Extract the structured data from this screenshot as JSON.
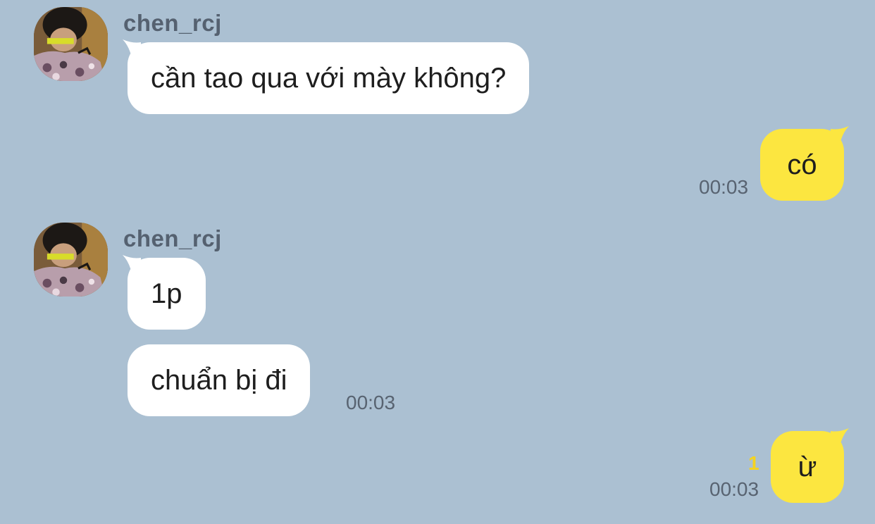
{
  "colors": {
    "background": "#abc0d2",
    "incoming_bubble": "#ffffff",
    "outgoing_bubble": "#fce640",
    "sender_name": "#556170",
    "timestamp": "#586371",
    "unread_count": "#f4d321"
  },
  "messages": [
    {
      "direction": "in",
      "sender": "chen_rcj",
      "avatar_icon": "user-avatar-photo",
      "text": "cần tao qua với mày không?"
    },
    {
      "direction": "out",
      "text": "có",
      "time": "00:03"
    },
    {
      "direction": "in",
      "sender": "chen_rcj",
      "avatar_icon": "user-avatar-photo",
      "text": "1p"
    },
    {
      "direction": "in",
      "text": "chuẩn bị đi",
      "time": "00:03"
    },
    {
      "direction": "out",
      "text": "ừ",
      "time": "00:03",
      "unread": "1"
    }
  ]
}
